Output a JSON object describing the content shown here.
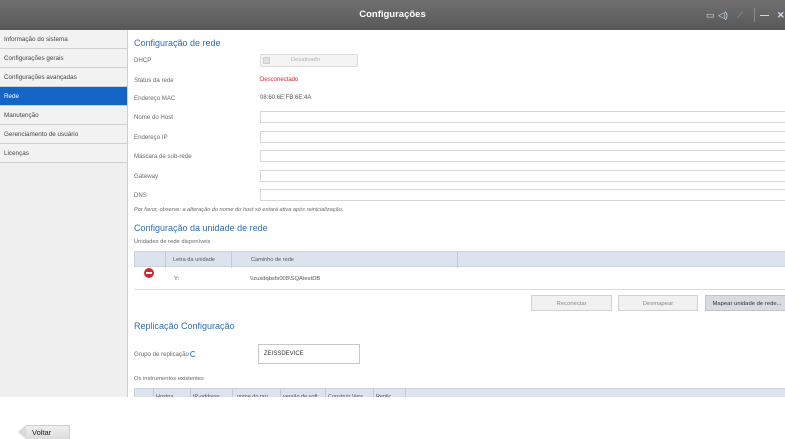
{
  "window": {
    "title": "Configurações",
    "controls": [
      "monitor-icon",
      "speaker-icon",
      "wrench-icon",
      "minimize-icon",
      "close-icon"
    ],
    "minimize_glyph": "—",
    "close_glyph": "✕"
  },
  "sidebar": {
    "items": [
      {
        "label": "Informação do sistema",
        "active": false
      },
      {
        "label": "Configurações gerais",
        "active": false
      },
      {
        "label": "Configurações avançadas",
        "active": false
      },
      {
        "label": "Rede",
        "active": true
      },
      {
        "label": "Manutenção",
        "active": false
      },
      {
        "label": "Gerenciamento de usuário",
        "active": false
      },
      {
        "label": "Licenças",
        "active": false
      }
    ]
  },
  "network": {
    "title": "Configuração de rede",
    "dhcp_label": "DHCP",
    "dhcp_value": "Desativado",
    "status_label": "Status da rede",
    "status_value": "Desconectado",
    "mac_label": "Endereço MAC",
    "mac_value": "08:60:6E:FB:6E:4A",
    "hostname_label": "Nome do Host",
    "hostname_value": "",
    "ip_label": "Endereço IP",
    "ip_value": "",
    "subnet_label": "Máscara de sub-rede",
    "subnet_value": "",
    "gateway_label": "Gateway",
    "gateway_value": "",
    "dns_label": "DNS",
    "dns_value": "",
    "note": "Por favor, observe: a alteração do nome do host só estará ativa após reinicialização."
  },
  "drives": {
    "title": "Configuração da unidade de rede",
    "subtitle": "Unidades de rede disponíveis",
    "columns": [
      "Letra da unidade",
      "Caminho de rede"
    ],
    "rows": [
      {
        "letter": "Y:",
        "path": "\\\\zusdqbsfs008\\SQAtestDB"
      }
    ],
    "buttons": {
      "reconnect": "Reconectar",
      "unmap": "Desmapear",
      "map": "Mapear unidade de rede..."
    }
  },
  "replication": {
    "title": "Replicação Configuração",
    "group_label": "Grupo de replicação",
    "group_value": "ZEISSDEVICE",
    "instruments_label": "Os instrumentos existentes",
    "columns": [
      "Hostna...",
      "IP-address",
      "nome do pro...",
      "versão de soft...",
      "Construir Vers...",
      "Replic..."
    ]
  },
  "footer": {
    "back_label": "Voltar"
  },
  "colors": {
    "titlebar": "#5f5f5f",
    "accent": "#1565c6",
    "status_error": "#d6262e",
    "section_title": "#2f6db5"
  }
}
